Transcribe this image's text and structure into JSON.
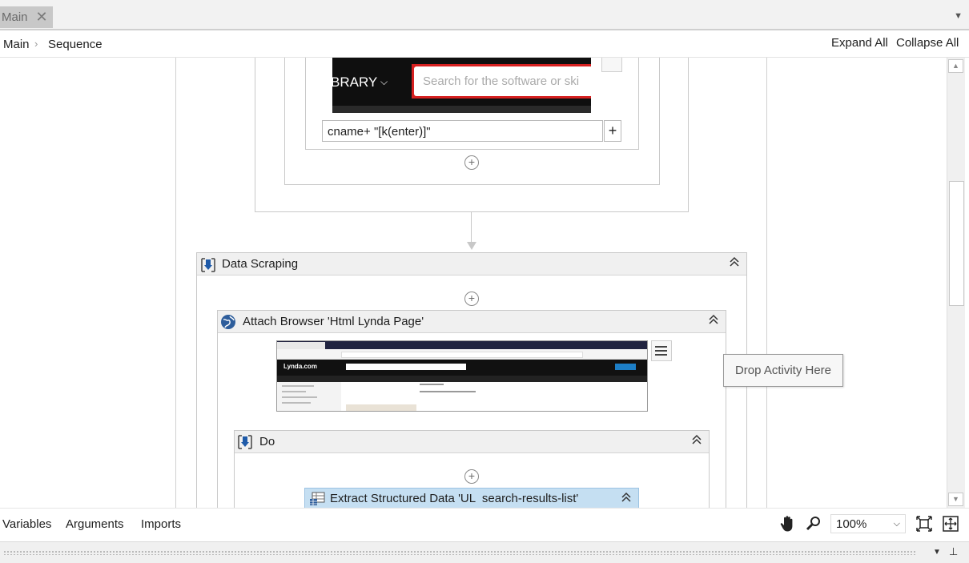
{
  "tabs": [
    {
      "label": "Main",
      "close_icon": "close-icon"
    }
  ],
  "breadcrumb": {
    "items": [
      "Main",
      "Sequence"
    ],
    "separator_icon": "chevron-right-icon"
  },
  "header_actions": {
    "expand_all": "Expand All",
    "collapse_all": "Collapse All"
  },
  "type_into": {
    "screenshot": {
      "nav_text": "BRARY",
      "search_placeholder": "Search for the software or ski"
    },
    "text_value": "cname+ \"[k(enter)]\"",
    "add_button": "+"
  },
  "data_scraping": {
    "title": "Data Scraping",
    "icon": "data-scraping-icon"
  },
  "attach_browser": {
    "title": "Attach Browser 'Html Lynda Page'",
    "icon": "globe-icon",
    "screenshot_logo": "Lynda.com"
  },
  "do_sequence": {
    "title": "Do",
    "icon": "sequence-icon"
  },
  "extract": {
    "title": "Extract Structured Data 'UL  search-results-list'",
    "icon": "table-icon"
  },
  "drop_tooltip": "Drop Activity Here",
  "bottom_tabs": [
    "Variables",
    "Arguments",
    "Imports"
  ],
  "zoom": {
    "value": "100%"
  },
  "colors": {
    "accent_blue": "#1e5aa8",
    "extract_header": "#c5dff2",
    "highlight_red": "#d62020"
  }
}
